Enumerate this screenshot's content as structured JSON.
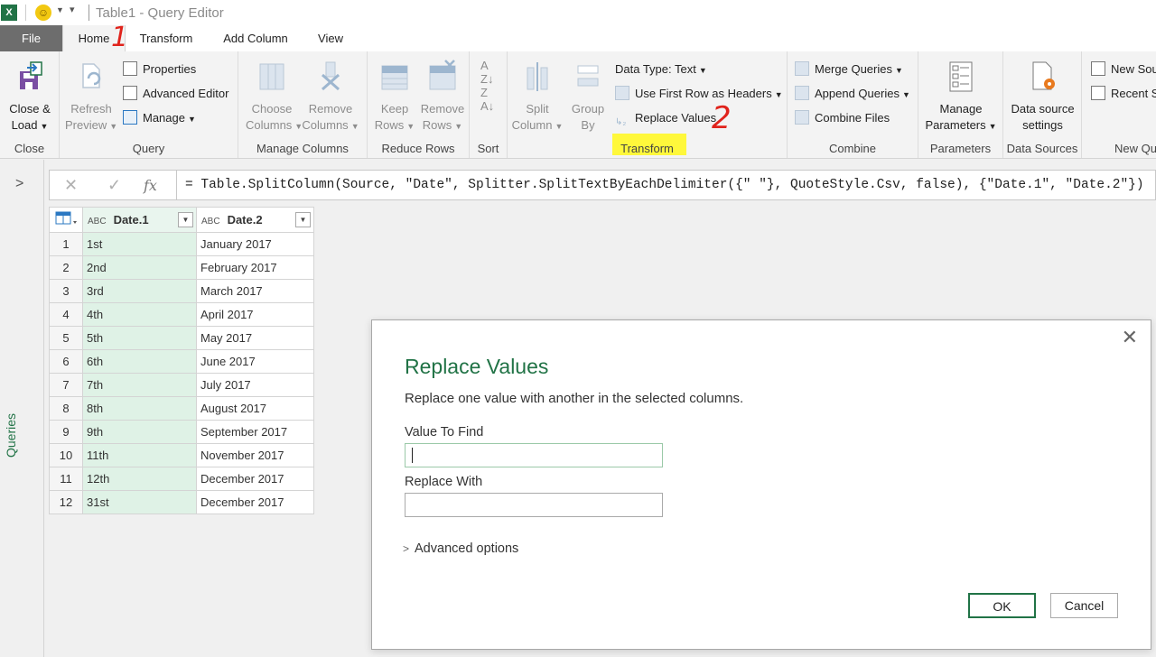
{
  "app": {
    "window_title": "Table1 - Query Editor",
    "app_icon": "X"
  },
  "tabs": [
    {
      "label": "File"
    },
    {
      "label": "Home"
    },
    {
      "label": "Transform"
    },
    {
      "label": "Add Column"
    },
    {
      "label": "View"
    }
  ],
  "ribbon": {
    "close_group": {
      "btn_label_1": "Close &",
      "btn_label_2": "Load",
      "group": "Close"
    },
    "query_group": {
      "refresh_1": "Refresh",
      "refresh_2": "Preview",
      "properties": "Properties",
      "advanced_editor": "Advanced Editor",
      "manage": "Manage",
      "group": "Query"
    },
    "manage_columns": {
      "choose_1": "Choose",
      "choose_2": "Columns",
      "remove_1": "Remove",
      "remove_2": "Columns",
      "group": "Manage Columns"
    },
    "reduce_rows": {
      "keep_1": "Keep",
      "keep_2": "Rows",
      "remove_1": "Remove",
      "remove_2": "Rows",
      "group": "Reduce Rows"
    },
    "sort": {
      "group": "Sort"
    },
    "transform": {
      "split_1": "Split",
      "split_2": "Column",
      "group_1": "Group",
      "group_2": "By",
      "data_type": "Data Type: Text",
      "first_row": "Use First Row as Headers",
      "replace_values": "Replace Values",
      "group": "Transform"
    },
    "combine": {
      "merge": "Merge Queries",
      "append": "Append Queries",
      "combine_files": "Combine Files",
      "group": "Combine"
    },
    "parameters": {
      "manage_1": "Manage",
      "manage_2": "Parameters",
      "group": "Parameters"
    },
    "data_sources": {
      "ds_1": "Data source",
      "ds_2": "settings",
      "group": "Data Sources"
    },
    "new_query": {
      "new_source": "New Sou",
      "recent": "Recent S",
      "group": "New Qu"
    }
  },
  "left_pane": {
    "label": "Queries"
  },
  "formula_bar": {
    "fx": "fx",
    "formula": "= Table.SplitColumn(Source, \"Date\", Splitter.SplitTextByEachDelimiter({\" \"}, QuoteStyle.Csv, false), {\"Date.1\", \"Date.2\"})"
  },
  "table": {
    "columns": [
      {
        "type": "ABC",
        "name": "Date.1"
      },
      {
        "type": "ABC",
        "name": "Date.2"
      }
    ],
    "rows": [
      {
        "n": "1",
        "c1": "1st",
        "c2": "January 2017"
      },
      {
        "n": "2",
        "c1": "2nd",
        "c2": "February 2017"
      },
      {
        "n": "3",
        "c1": "3rd",
        "c2": "March 2017"
      },
      {
        "n": "4",
        "c1": "4th",
        "c2": "April 2017"
      },
      {
        "n": "5",
        "c1": "5th",
        "c2": "May 2017"
      },
      {
        "n": "6",
        "c1": "6th",
        "c2": "June 2017"
      },
      {
        "n": "7",
        "c1": "7th",
        "c2": "July 2017"
      },
      {
        "n": "8",
        "c1": "8th",
        "c2": "August 2017"
      },
      {
        "n": "9",
        "c1": "9th",
        "c2": "September 2017"
      },
      {
        "n": "10",
        "c1": "11th",
        "c2": "November 2017"
      },
      {
        "n": "11",
        "c1": "12th",
        "c2": "December 2017"
      },
      {
        "n": "12",
        "c1": "31st",
        "c2": "December 2017"
      }
    ]
  },
  "dialog": {
    "title": "Replace Values",
    "description": "Replace one value with another in the selected columns.",
    "value_to_find_label": "Value To Find",
    "value_to_find": "",
    "replace_with_label": "Replace With",
    "replace_with": "",
    "advanced_options": "Advanced options",
    "ok": "OK",
    "cancel": "Cancel"
  },
  "annotations": {
    "one": "1",
    "two": "2"
  },
  "colors": {
    "accent": "#217346",
    "highlight": "#fff83b",
    "annotation": "#e0231c",
    "selected_column": "#dff2e6"
  }
}
